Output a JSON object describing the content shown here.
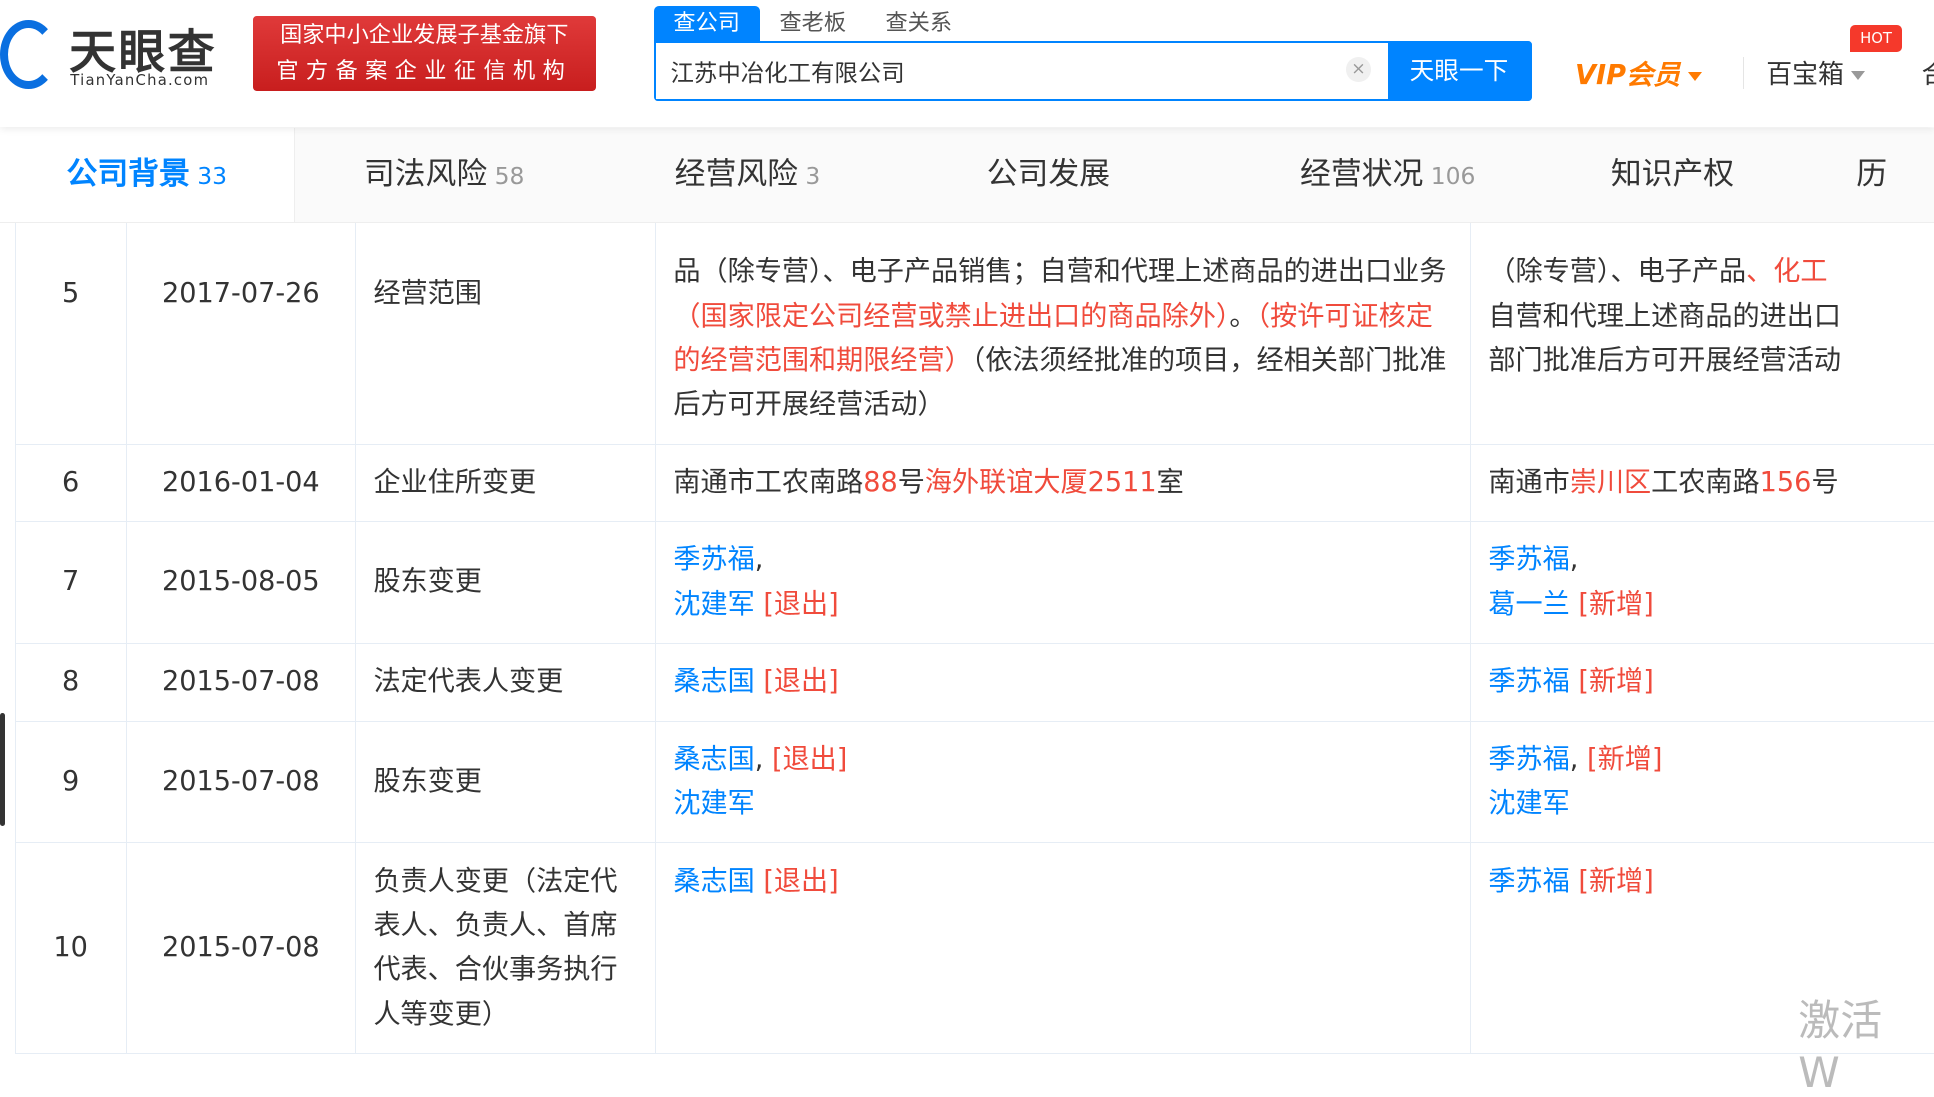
{
  "header": {
    "logo_cn": "天眼查",
    "logo_en": "TianYanCha.com",
    "badge_line1": "国家中小企业发展子基金旗下",
    "badge_line2": "官方备案企业征信机构",
    "search_tabs": [
      "查公司",
      "查老板",
      "查关系"
    ],
    "search_value": "江苏中冶化工有限公司",
    "clear_icon": "×",
    "search_button": "天眼一下",
    "vip": "VIP会员",
    "toolbox": "百宝箱",
    "hot": "HOT",
    "more": "合"
  },
  "nav": [
    {
      "label": "公司背景",
      "count": "33"
    },
    {
      "label": "司法风险",
      "count": "58"
    },
    {
      "label": "经营风险",
      "count": "3"
    },
    {
      "label": "公司发展",
      "count": ""
    },
    {
      "label": "经营状况",
      "count": "106"
    },
    {
      "label": "知识产权",
      "count": ""
    },
    {
      "label": "历",
      "count": ""
    }
  ],
  "rows": [
    {
      "no": "5",
      "date": "2017-07-26",
      "type": "经营范围",
      "lead": true,
      "before": [
        [
          [
            "品（除专营）、电子产品销售；自营和代理上述商品的进出口业务",
            ""
          ],
          [
            "（国家限定公司经营或禁止进出口的商品除外）",
            "red"
          ],
          [
            "。",
            ""
          ],
          [
            "（按许可证核定的经营范围和期限经营）",
            "red"
          ],
          [
            "（依法须经批准的项目，经相关部门批准后方可开展经营活动）",
            ""
          ]
        ]
      ],
      "after": [
        [
          [
            "（除专营）、电子产品",
            ""
          ],
          [
            "、化工",
            "red"
          ]
        ],
        [
          [
            "自营和代理上述商品的进出口",
            ""
          ]
        ],
        [
          [
            "部门批准后方可开展经营活动",
            ""
          ]
        ]
      ]
    },
    {
      "no": "6",
      "date": "2016-01-04",
      "type": "企业住所变更",
      "before": [
        [
          [
            "南通市工农南路",
            ""
          ],
          [
            "88",
            "red"
          ],
          [
            "号",
            ""
          ],
          [
            "海外联谊大厦2511",
            "red"
          ],
          [
            "室",
            ""
          ]
        ]
      ],
      "after": [
        [
          [
            "南通市",
            ""
          ],
          [
            "崇川区",
            "red"
          ],
          [
            "工农南路",
            ""
          ],
          [
            "156",
            "red"
          ],
          [
            "号",
            ""
          ]
        ]
      ]
    },
    {
      "no": "7",
      "date": "2015-08-05",
      "type": "股东变更",
      "before": [
        [
          [
            "季苏福",
            "blue"
          ],
          [
            ",",
            ""
          ]
        ],
        [
          [
            "沈建军",
            "blue"
          ],
          [
            " [退出]",
            "red"
          ]
        ]
      ],
      "after": [
        [
          [
            "季苏福",
            "blue"
          ],
          [
            ",",
            ""
          ]
        ],
        [
          [
            "葛一兰",
            "blue"
          ],
          [
            " [新增]",
            "red"
          ]
        ]
      ]
    },
    {
      "no": "8",
      "date": "2015-07-08",
      "type": "法定代表人变更",
      "before": [
        [
          [
            "桑志国",
            "blue"
          ],
          [
            " [退出]",
            "red"
          ]
        ]
      ],
      "after": [
        [
          [
            "季苏福",
            "blue"
          ],
          [
            " [新增]",
            "red"
          ]
        ]
      ]
    },
    {
      "no": "9",
      "date": "2015-07-08",
      "type": "股东变更",
      "before": [
        [
          [
            "桑志国",
            "blue"
          ],
          [
            ", ",
            ""
          ],
          [
            "[退出]",
            "red"
          ]
        ],
        [
          [
            "沈建军",
            "blue"
          ]
        ]
      ],
      "after": [
        [
          [
            "季苏福",
            "blue"
          ],
          [
            ", ",
            ""
          ],
          [
            "[新增]",
            "red"
          ]
        ],
        [
          [
            "沈建军",
            "blue"
          ]
        ]
      ]
    },
    {
      "no": "10",
      "date": "2015-07-08",
      "type": "负责人变更（法定代表人、负责人、首席代表、合伙事务执行人等变更）",
      "before": [
        [
          [
            "桑志国",
            "blue"
          ],
          [
            " [退出]",
            "red"
          ]
        ]
      ],
      "after": [
        [
          [
            "季苏福",
            "blue"
          ],
          [
            " [新增]",
            "red"
          ]
        ]
      ]
    }
  ],
  "watermark": "激活 W"
}
